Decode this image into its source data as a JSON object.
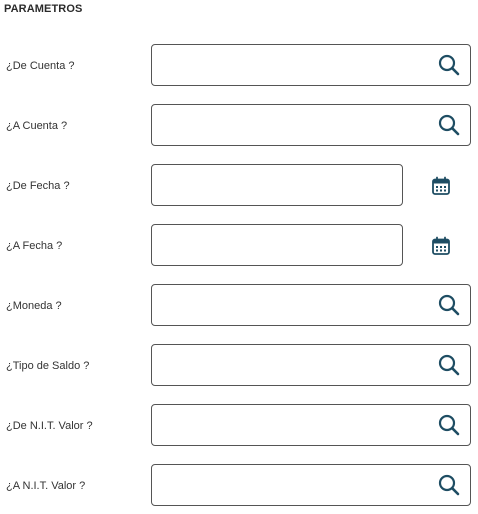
{
  "section": {
    "title": "PARAMETROS"
  },
  "colors": {
    "icon": "#1e4d63",
    "border": "#555555",
    "text": "#333333"
  },
  "fields": [
    {
      "label": "¿De Cuenta ?",
      "value": "",
      "kind": "lookup",
      "icon": "search-icon"
    },
    {
      "label": "¿A Cuenta ?",
      "value": "",
      "kind": "lookup",
      "icon": "search-icon"
    },
    {
      "label": "¿De Fecha ?",
      "value": "",
      "kind": "date",
      "icon": "calendar-icon"
    },
    {
      "label": "¿A Fecha ?",
      "value": "",
      "kind": "date",
      "icon": "calendar-icon"
    },
    {
      "label": "¿Moneda ?",
      "value": "",
      "kind": "lookup",
      "icon": "search-icon"
    },
    {
      "label": "¿Tipo de Saldo ?",
      "value": "",
      "kind": "lookup",
      "icon": "search-icon"
    },
    {
      "label": "¿De N.I.T. Valor ?",
      "value": "",
      "kind": "lookup",
      "icon": "search-icon"
    },
    {
      "label": "¿A N.I.T. Valor ?",
      "value": "",
      "kind": "lookup",
      "icon": "search-icon"
    }
  ]
}
